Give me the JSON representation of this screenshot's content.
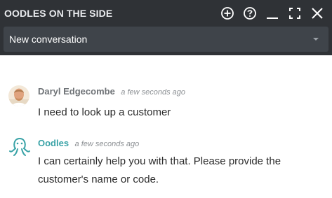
{
  "header": {
    "title": "OODLES ON THE SIDE",
    "icons": [
      "add-circle-icon",
      "help-circle-icon",
      "minimize-icon",
      "fullscreen-icon",
      "close-icon"
    ],
    "background": "#2f3236"
  },
  "conversation_select": {
    "value": "New conversation"
  },
  "messages": [
    {
      "author": "Daryl Edgecombe",
      "time": "a few seconds ago",
      "text": "I need to look up a customer",
      "avatar": "user-avatar"
    },
    {
      "author": "Oodles",
      "time": "a few seconds ago",
      "text": "I can certainly help you with that. Please provide the customer's name or code.",
      "avatar": "octopus-icon",
      "accent": "#3aa3a7"
    }
  ]
}
